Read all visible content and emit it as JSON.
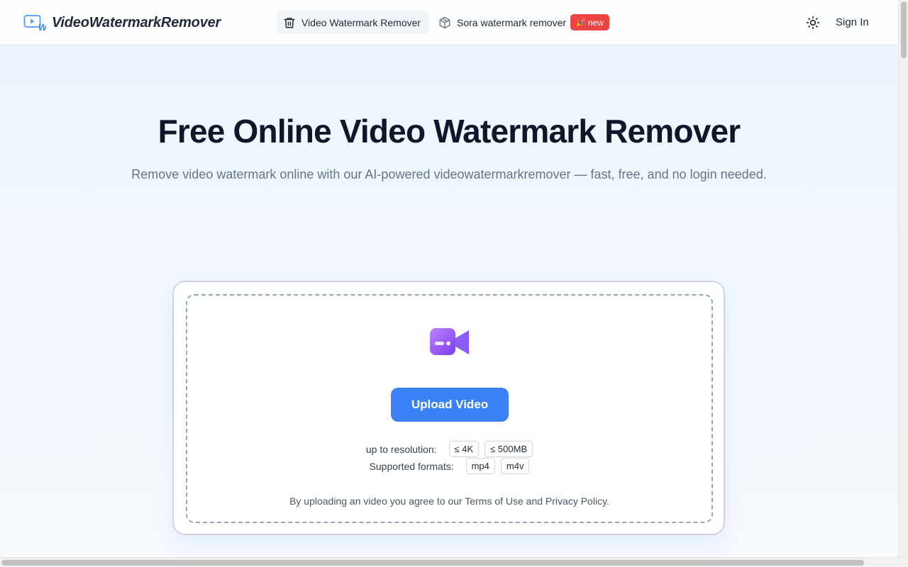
{
  "header": {
    "logo_text": "VideoWatermarkRemover",
    "nav": [
      {
        "label": "Video Watermark Remover",
        "icon": "trash-icon",
        "active": true
      },
      {
        "label": "Sora watermark remover",
        "icon": "cube-icon",
        "badge": "new",
        "badge_emoji": "🎉"
      }
    ],
    "theme_icon": "sun-icon",
    "signin_label": "Sign In"
  },
  "hero": {
    "title": "Free Online Video Watermark Remover",
    "subtitle": "Remove video watermark online with our AI-powered videowatermarkremover — fast, free, and no login needed."
  },
  "upload": {
    "icon": "video-camera-icon",
    "button_label": "Upload Video",
    "resolution_label": "up to resolution:",
    "resolution_tags": [
      "≤ 4K",
      "≤ 500MB"
    ],
    "formats_label": "Supported formats:",
    "format_tags": [
      "mp4",
      "m4v"
    ],
    "terms_text": "By uploading an video you agree to our Terms of Use and Privacy Policy."
  },
  "colors": {
    "accent": "#3b82f6",
    "badge": "#ef4444",
    "icon_purple": "#8b5cf6"
  }
}
